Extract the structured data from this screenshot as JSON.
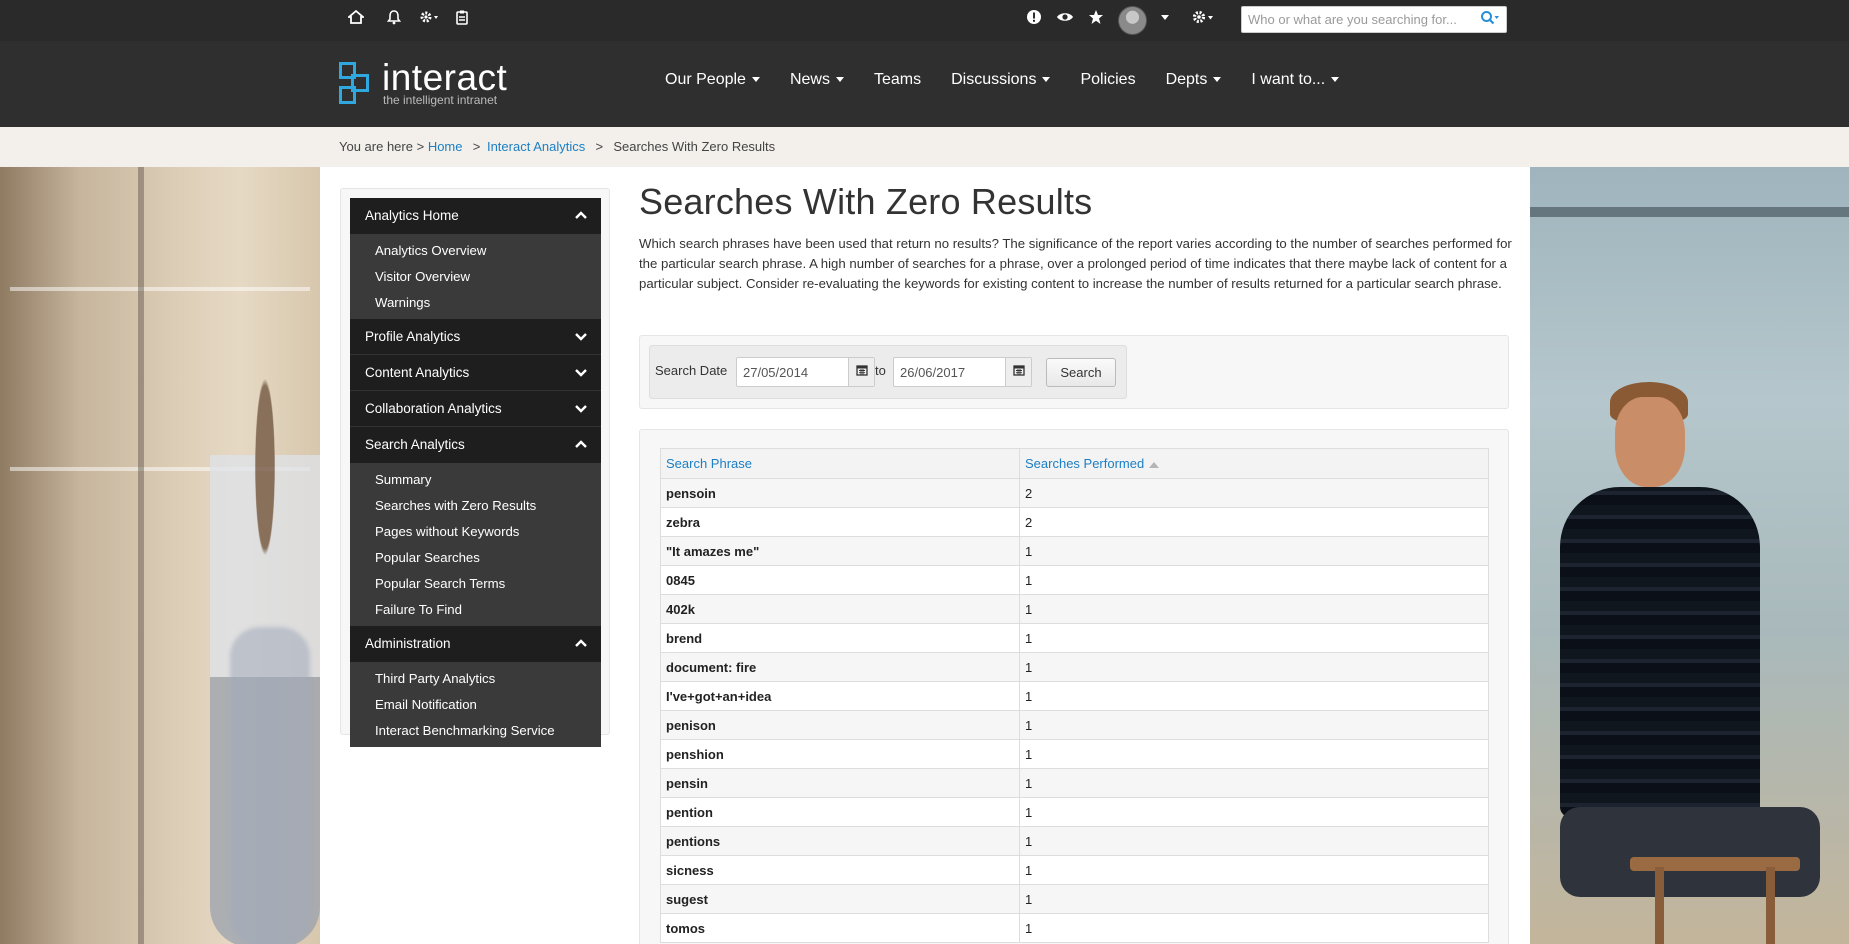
{
  "topbar": {
    "search": {
      "placeholder": "Who or what are you searching for..."
    }
  },
  "logo": {
    "name": "interact",
    "tagline": "the intelligent intranet"
  },
  "nav": {
    "items": [
      {
        "label": "Our People",
        "dropdown": true
      },
      {
        "label": "News",
        "dropdown": true
      },
      {
        "label": "Teams",
        "dropdown": false
      },
      {
        "label": "Discussions",
        "dropdown": true
      },
      {
        "label": "Policies",
        "dropdown": false
      },
      {
        "label": "Depts",
        "dropdown": true
      },
      {
        "label": "I want to...",
        "dropdown": true
      }
    ]
  },
  "breadcrumb": {
    "prefix": "You are here >",
    "home": "Home",
    "analytics": "Interact Analytics",
    "current": "Searches With Zero Results"
  },
  "sidebar": {
    "sections": [
      {
        "label": "Analytics Home",
        "expanded": true,
        "links": [
          "Analytics Overview",
          "Visitor Overview",
          "Warnings"
        ]
      },
      {
        "label": "Profile Analytics",
        "expanded": false,
        "links": []
      },
      {
        "label": "Content Analytics",
        "expanded": false,
        "links": []
      },
      {
        "label": "Collaboration Analytics",
        "expanded": false,
        "links": []
      },
      {
        "label": "Search Analytics",
        "expanded": true,
        "links": [
          "Summary",
          "Searches with Zero Results",
          "Pages without Keywords",
          "Popular Searches",
          "Popular Search Terms",
          "Failure To Find"
        ]
      },
      {
        "label": "Administration",
        "expanded": true,
        "links": [
          "Third Party Analytics",
          "Email Notification",
          "Interact Benchmarking Service"
        ]
      }
    ]
  },
  "main": {
    "title": "Searches With Zero Results",
    "description": "Which search phrases have been used that return no results? The significance of the report varies according to the number of searches performed for the particular search phrase. A high number of searches for a phrase, over a prolonged period of time indicates that there maybe lack of content for a particular subject. Consider re-evaluating the keywords for existing content to increase the number of results returned for a particular search phrase.",
    "filter": {
      "label": "Search Date",
      "from": "27/05/2014",
      "to_label": "to",
      "to": "26/06/2017",
      "button": "Search"
    },
    "table": {
      "columns": [
        "Search Phrase",
        "Searches Performed"
      ],
      "rows": [
        [
          "pensoin",
          "2"
        ],
        [
          "zebra",
          "2"
        ],
        [
          "\"It amazes me\"",
          "1"
        ],
        [
          "0845",
          "1"
        ],
        [
          "402k",
          "1"
        ],
        [
          "brend",
          "1"
        ],
        [
          "document: fire",
          "1"
        ],
        [
          "I've+got+an+idea",
          "1"
        ],
        [
          "penison",
          "1"
        ],
        [
          "penshion",
          "1"
        ],
        [
          "pensin",
          "1"
        ],
        [
          "pention",
          "1"
        ],
        [
          "pentions",
          "1"
        ],
        [
          "sicness",
          "1"
        ],
        [
          "sugest",
          "1"
        ],
        [
          "tomos",
          "1"
        ]
      ]
    }
  },
  "colors": {
    "accent": "#2fa8e0",
    "link": "#1b7fc4",
    "topbar": "#2a2a2a",
    "header": "#2f2f2f",
    "sidebar_head": "#1e1e1e",
    "sidebar_sub": "#3a3a3a"
  }
}
